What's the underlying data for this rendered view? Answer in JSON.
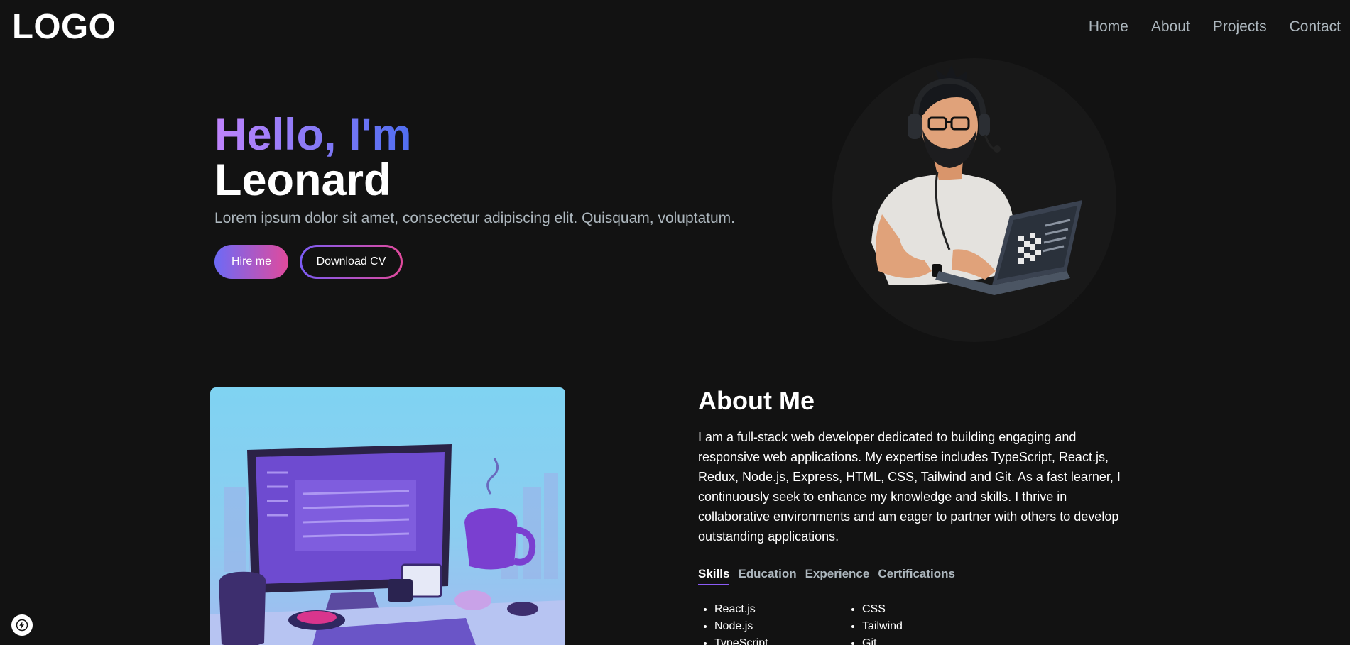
{
  "navbar": {
    "logo": "LOGO",
    "links": [
      {
        "label": "Home"
      },
      {
        "label": "About"
      },
      {
        "label": "Projects"
      },
      {
        "label": "Contact"
      }
    ]
  },
  "hero": {
    "greeting": "Hello, I'm",
    "name": "Leonard",
    "description": "Lorem ipsum dolor sit amet, consectetur adipiscing elit. Quisquam, voluptatum.",
    "hire_label": "Hire me",
    "cv_label": "Download CV"
  },
  "about": {
    "title": "About Me",
    "body": "I am a full-stack web developer dedicated to building engaging and responsive web applications. My expertise includes TypeScript, React.js, Redux, Node.js, Express, HTML, CSS, Tailwind and Git. As a fast learner, I continuously seek to enhance my knowledge and skills. I thrive in collaborative environments and am eager to partner with others to develop outstanding applications.",
    "tabs": [
      {
        "label": "Skills",
        "active": true
      },
      {
        "label": "Education"
      },
      {
        "label": "Experience"
      },
      {
        "label": "Certifications"
      }
    ],
    "skills_col1": [
      "React.js",
      "Node.js",
      "TypeScript"
    ],
    "skills_col2": [
      "CSS",
      "Tailwind",
      "Git"
    ]
  },
  "colors": {
    "background": "#121212",
    "muted_text": "#adb7be",
    "gradient_start": "#c084fc",
    "gradient_end": "#4f6ef0",
    "accent_pink": "#e14a9c"
  },
  "icons": {
    "badge": "lightning-bolt-icon"
  }
}
